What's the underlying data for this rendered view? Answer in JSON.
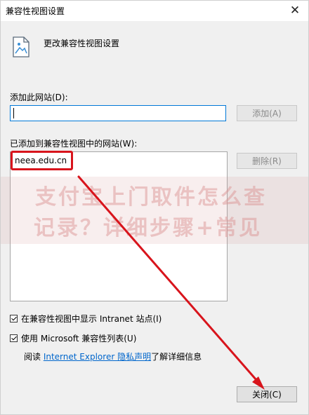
{
  "window": {
    "title": "兼容性视图设置"
  },
  "header": {
    "text": "更改兼容性视图设置",
    "icon": "document-settings-icon"
  },
  "add_site": {
    "label": "添加此网站(D):",
    "input_value": "",
    "add_button": "添加(A)"
  },
  "sites": {
    "label": "已添加到兼容性视图中的网站(W):",
    "items": [
      "neea.edu.cn"
    ],
    "remove_button": "删除(R)"
  },
  "options": {
    "intranet": {
      "label": "在兼容性视图中显示 Intranet 站点(I)",
      "checked": true
    },
    "ms_list": {
      "label": "使用 Microsoft 兼容性列表(U)",
      "checked": true
    }
  },
  "info": {
    "prefix": "阅读 ",
    "link": "Internet Explorer 隐私声明",
    "suffix": "了解详细信息"
  },
  "close_button": "关闭(C)",
  "watermark": {
    "line1": "支付宝上门取件怎么查",
    "line2": "记录？详细步骤+常见"
  },
  "annotation_color": "#d8141c"
}
